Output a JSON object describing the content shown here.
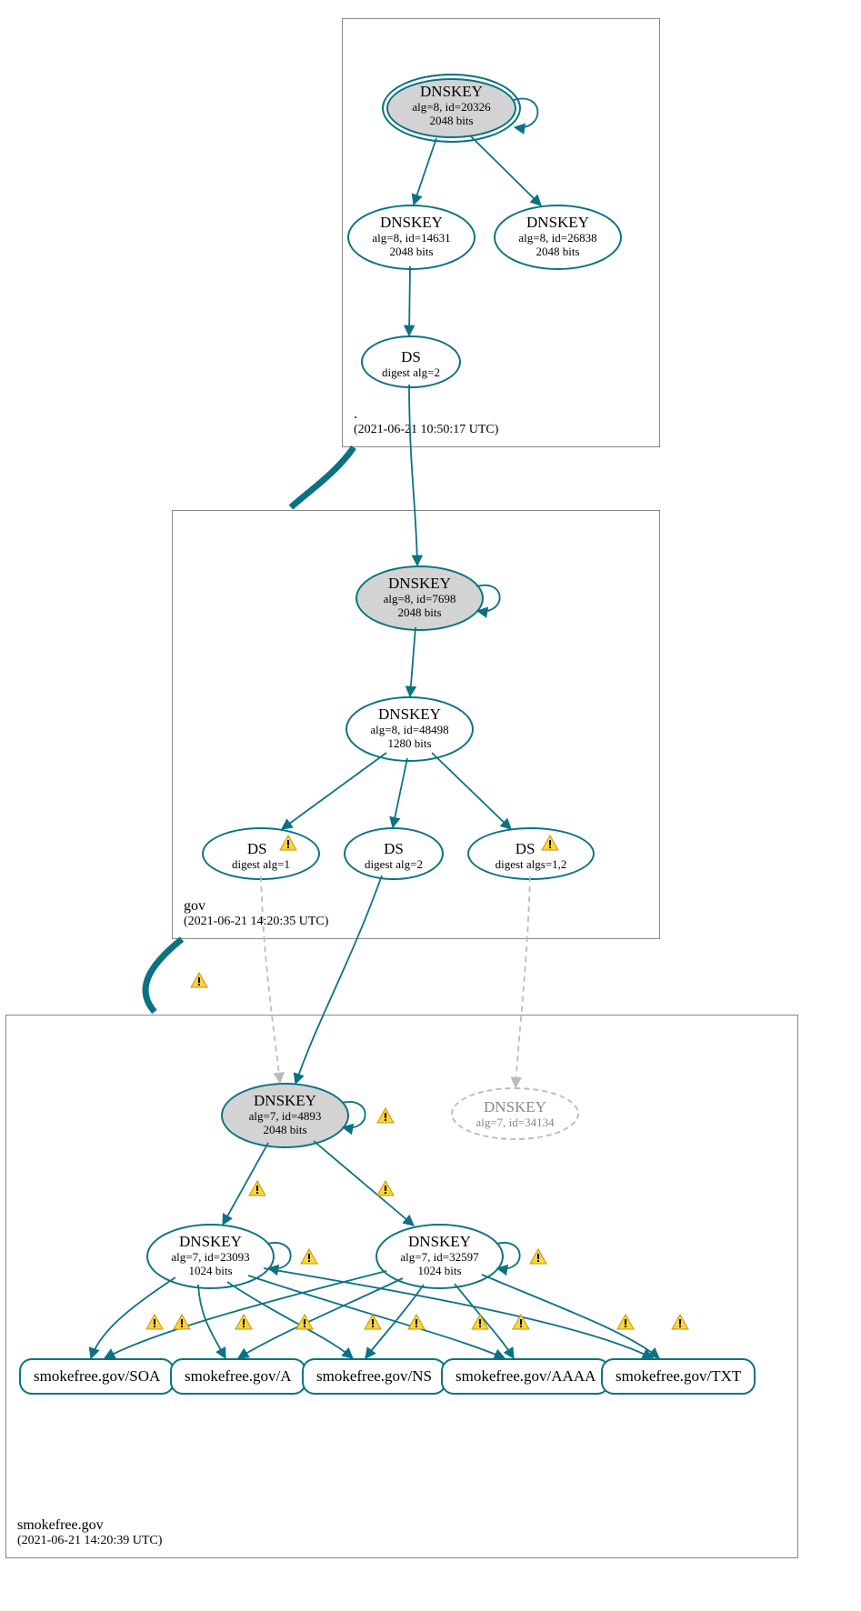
{
  "chart_data": {
    "type": "diagram",
    "description": "DNSSEC authentication graph for smokefree.gov showing chain of trust from root (.) through gov to smokefree.gov, with DNSKEY, DS, and RRset records and warning annotations.",
    "zones": [
      {
        "id": "root",
        "name": ".",
        "timestamp": "(2021-06-21 10:50:17 UTC)"
      },
      {
        "id": "gov",
        "name": "gov",
        "timestamp": "(2021-06-21 14:20:35 UTC)"
      },
      {
        "id": "smokefree",
        "name": "smokefree.gov",
        "timestamp": "(2021-06-21 14:20:39 UTC)"
      }
    ],
    "nodes": [
      {
        "id": "root-ksk",
        "zone": "root",
        "type": "DNSKEY",
        "alg": 8,
        "key_id": 20326,
        "bits": 2048,
        "sep": true,
        "trust_anchor": true
      },
      {
        "id": "root-zsk-14631",
        "zone": "root",
        "type": "DNSKEY",
        "alg": 8,
        "key_id": 14631,
        "bits": 2048
      },
      {
        "id": "root-zsk-26838",
        "zone": "root",
        "type": "DNSKEY",
        "alg": 8,
        "key_id": 26838,
        "bits": 2048
      },
      {
        "id": "root-ds-gov",
        "zone": "root",
        "type": "DS",
        "digest_algs": [
          2
        ]
      },
      {
        "id": "gov-ksk",
        "zone": "gov",
        "type": "DNSKEY",
        "alg": 8,
        "key_id": 7698,
        "bits": 2048,
        "sep": true
      },
      {
        "id": "gov-zsk",
        "zone": "gov",
        "type": "DNSKEY",
        "alg": 8,
        "key_id": 48498,
        "bits": 1280
      },
      {
        "id": "gov-ds-1",
        "zone": "gov",
        "type": "DS",
        "digest_algs": [
          1
        ],
        "warning": true
      },
      {
        "id": "gov-ds-2",
        "zone": "gov",
        "type": "DS",
        "digest_algs": [
          2
        ]
      },
      {
        "id": "gov-ds-12",
        "zone": "gov",
        "type": "DS",
        "digest_algs": [
          1,
          2
        ],
        "warning": true
      },
      {
        "id": "sf-ksk",
        "zone": "smokefree",
        "type": "DNSKEY",
        "alg": 7,
        "key_id": 4893,
        "bits": 2048,
        "sep": true,
        "warning": true
      },
      {
        "id": "sf-key-34134",
        "zone": "smokefree",
        "type": "DNSKEY",
        "alg": 7,
        "key_id": 34134,
        "dashed": true
      },
      {
        "id": "sf-zsk-23093",
        "zone": "smokefree",
        "type": "DNSKEY",
        "alg": 7,
        "key_id": 23093,
        "bits": 1024,
        "warning": true
      },
      {
        "id": "sf-zsk-32597",
        "zone": "smokefree",
        "type": "DNSKEY",
        "alg": 7,
        "key_id": 32597,
        "bits": 1024,
        "warning": true
      },
      {
        "id": "rr-soa",
        "zone": "smokefree",
        "type": "RRset",
        "name": "smokefree.gov/SOA"
      },
      {
        "id": "rr-a",
        "zone": "smokefree",
        "type": "RRset",
        "name": "smokefree.gov/A"
      },
      {
        "id": "rr-ns",
        "zone": "smokefree",
        "type": "RRset",
        "name": "smokefree.gov/NS"
      },
      {
        "id": "rr-aaaa",
        "zone": "smokefree",
        "type": "RRset",
        "name": "smokefree.gov/AAAA"
      },
      {
        "id": "rr-txt",
        "zone": "smokefree",
        "type": "RRset",
        "name": "smokefree.gov/TXT"
      }
    ],
    "edges": [
      {
        "from": "root-ksk",
        "to": "root-ksk",
        "self": true
      },
      {
        "from": "root-ksk",
        "to": "root-zsk-14631"
      },
      {
        "from": "root-ksk",
        "to": "root-zsk-26838"
      },
      {
        "from": "root-zsk-14631",
        "to": "root-ds-gov"
      },
      {
        "from": "root",
        "to": "gov",
        "delegation": true
      },
      {
        "from": "root-ds-gov",
        "to": "gov-ksk"
      },
      {
        "from": "gov-ksk",
        "to": "gov-ksk",
        "self": true
      },
      {
        "from": "gov-ksk",
        "to": "gov-zsk"
      },
      {
        "from": "gov-zsk",
        "to": "gov-ds-1"
      },
      {
        "from": "gov-zsk",
        "to": "gov-ds-2"
      },
      {
        "from": "gov-zsk",
        "to": "gov-ds-12"
      },
      {
        "from": "gov",
        "to": "smokefree",
        "delegation": true,
        "warning": true
      },
      {
        "from": "gov-ds-1",
        "to": "sf-ksk",
        "dashed": true
      },
      {
        "from": "gov-ds-2",
        "to": "sf-ksk"
      },
      {
        "from": "gov-ds-12",
        "to": "sf-key-34134",
        "dashed": true
      },
      {
        "from": "sf-ksk",
        "to": "sf-ksk",
        "self": true,
        "warning": true
      },
      {
        "from": "sf-ksk",
        "to": "sf-zsk-23093",
        "warning": true
      },
      {
        "from": "sf-ksk",
        "to": "sf-zsk-32597",
        "warning": true
      },
      {
        "from": "sf-zsk-23093",
        "to": "sf-zsk-23093",
        "self": true,
        "warning": true
      },
      {
        "from": "sf-zsk-32597",
        "to": "sf-zsk-32597",
        "self": true,
        "warning": true
      },
      {
        "from": "sf-zsk-23093",
        "to": "rr-soa",
        "warning": true
      },
      {
        "from": "sf-zsk-23093",
        "to": "rr-a",
        "warning": true
      },
      {
        "from": "sf-zsk-23093",
        "to": "rr-ns",
        "warning": true
      },
      {
        "from": "sf-zsk-23093",
        "to": "rr-aaaa",
        "warning": true
      },
      {
        "from": "sf-zsk-23093",
        "to": "rr-txt",
        "warning": true
      },
      {
        "from": "sf-zsk-32597",
        "to": "rr-soa",
        "warning": true
      },
      {
        "from": "sf-zsk-32597",
        "to": "rr-a",
        "warning": true
      },
      {
        "from": "sf-zsk-32597",
        "to": "rr-ns",
        "warning": true
      },
      {
        "from": "sf-zsk-32597",
        "to": "rr-aaaa",
        "warning": true
      },
      {
        "from": "sf-zsk-32597",
        "to": "rr-txt",
        "warning": true
      }
    ]
  },
  "zones": {
    "root": {
      "name": ".",
      "time": "(2021-06-21 10:50:17 UTC)"
    },
    "gov": {
      "name": "gov",
      "time": "(2021-06-21 14:20:35 UTC)"
    },
    "smokefree": {
      "name": "smokefree.gov",
      "time": "(2021-06-21 14:20:39 UTC)"
    }
  },
  "labels": {
    "dnskey": "DNSKEY",
    "ds": "DS"
  },
  "nodes": {
    "root_ksk": {
      "l1": "alg=8, id=20326",
      "l2": "2048 bits"
    },
    "root_14631": {
      "l1": "alg=8, id=14631",
      "l2": "2048 bits"
    },
    "root_26838": {
      "l1": "alg=8, id=26838",
      "l2": "2048 bits"
    },
    "root_ds": {
      "l1": "digest alg=2"
    },
    "gov_ksk": {
      "l1": "alg=8, id=7698",
      "l2": "2048 bits"
    },
    "gov_zsk": {
      "l1": "alg=8, id=48498",
      "l2": "1280 bits"
    },
    "gov_ds1": {
      "l1": "digest alg=1"
    },
    "gov_ds2": {
      "l1": "digest alg=2"
    },
    "gov_ds12": {
      "l1": "digest algs=1,2"
    },
    "sf_ksk": {
      "l1": "alg=7, id=4893",
      "l2": "2048 bits"
    },
    "sf_34134": {
      "l1": "alg=7, id=34134"
    },
    "sf_23093": {
      "l1": "alg=7, id=23093",
      "l2": "1024 bits"
    },
    "sf_32597": {
      "l1": "alg=7, id=32597",
      "l2": "1024 bits"
    },
    "rr_soa": "smokefree.gov/SOA",
    "rr_a": "smokefree.gov/A",
    "rr_ns": "smokefree.gov/NS",
    "rr_aaaa": "smokefree.gov/AAAA",
    "rr_txt": "smokefree.gov/TXT"
  }
}
